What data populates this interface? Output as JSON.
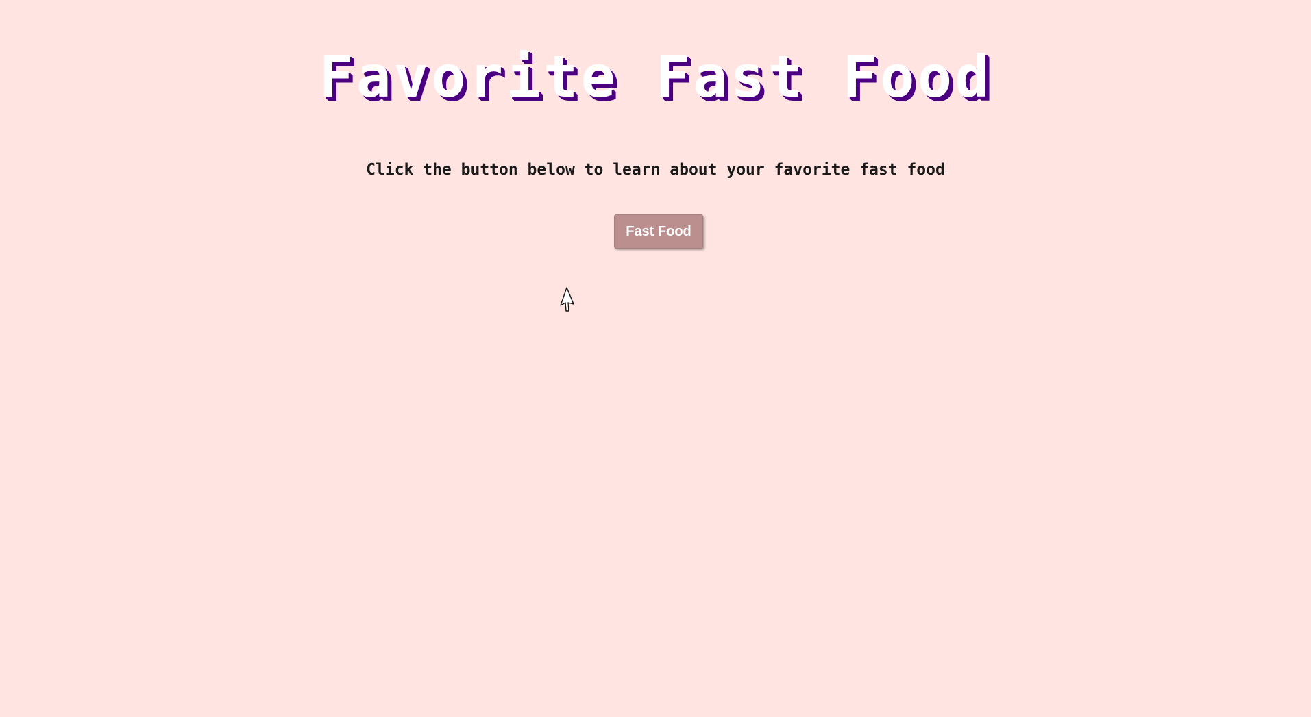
{
  "page": {
    "title": "Favorite Fast Food",
    "subtitle": "Click the button below to learn about your favorite fast food",
    "button_label": "Fast Food"
  },
  "colors": {
    "background": "#ffe4e1",
    "title_text": "#ffffff",
    "title_shadow": "#4b0082",
    "button_bg": "#bc8f8f",
    "button_text": "#ffffff"
  },
  "icons": {
    "cursor": "mouse-pointer-icon"
  }
}
